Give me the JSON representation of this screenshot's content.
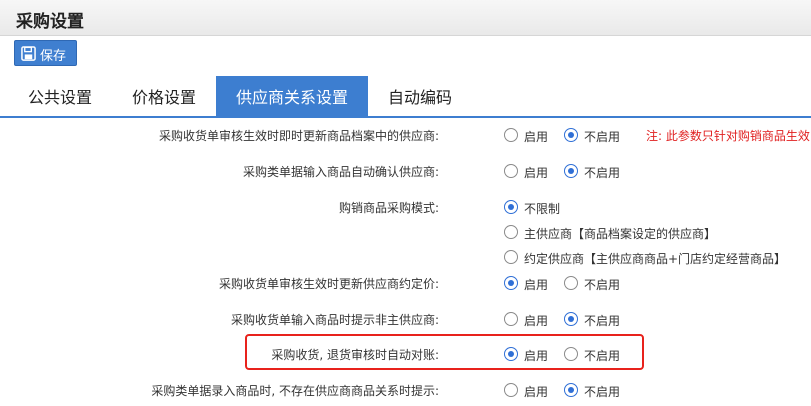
{
  "window": {
    "title": "采购设置"
  },
  "toolbar": {
    "save_label": "保存",
    "save_icon": "save-icon"
  },
  "tabs": [
    {
      "label": "公共设置",
      "active": false
    },
    {
      "label": "价格设置",
      "active": false
    },
    {
      "label": "供应商关系设置",
      "active": true
    },
    {
      "label": "自动编码",
      "active": false
    }
  ],
  "accent_color": "#3d7ed0",
  "settings": [
    {
      "label": "采购收货单审核生效时即时更新商品档案中的供应商:",
      "options": [
        "启用",
        "不启用"
      ],
      "selected": 1,
      "note": "注: 此参数只针对购销商品生效"
    },
    {
      "label": "采购类单据输入商品自动确认供应商:",
      "options": [
        "启用",
        "不启用"
      ],
      "selected": 1
    },
    {
      "label": "购销商品采购模式:",
      "options": [
        "不限制",
        "主供应商【商品档案设定的供应商】",
        "约定供应商【主供应商商品+门店约定经营商品】"
      ],
      "selected": 0
    },
    {
      "label": "采购收货单审核生效时更新供应商约定价:",
      "options": [
        "启用",
        "不启用"
      ],
      "selected": 0
    },
    {
      "label": "采购收货单输入商品时提示非主供应商:",
      "options": [
        "启用",
        "不启用"
      ],
      "selected": 1
    },
    {
      "label": "采购收货, 退货审核时自动对账:",
      "options": [
        "启用",
        "不启用"
      ],
      "selected": 0,
      "highlighted": true
    },
    {
      "label": "采购类单据录入商品时, 不存在供应商商品关系时提示:",
      "options": [
        "启用",
        "不启用"
      ],
      "selected": 1
    }
  ]
}
